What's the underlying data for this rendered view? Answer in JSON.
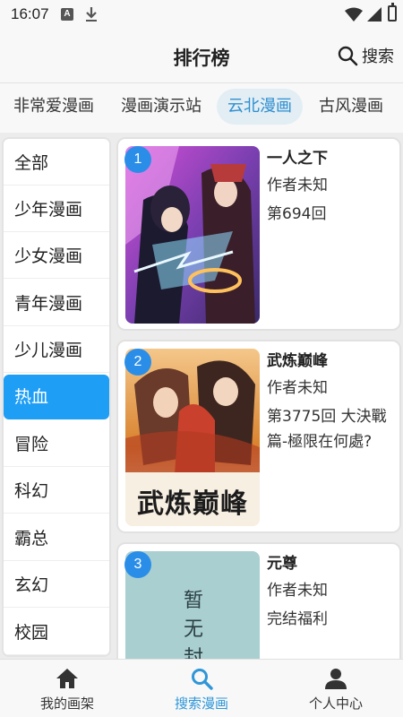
{
  "status": {
    "time": "16:07"
  },
  "header": {
    "title": "排行榜",
    "search_label": "搜索"
  },
  "tabs": [
    {
      "label": "非常爱漫画",
      "active": false
    },
    {
      "label": "漫画演示站",
      "active": false
    },
    {
      "label": "云北漫画",
      "active": true
    },
    {
      "label": "古风漫画",
      "active": false
    }
  ],
  "categories": [
    {
      "label": "全部",
      "active": false
    },
    {
      "label": "少年漫画",
      "active": false
    },
    {
      "label": "少女漫画",
      "active": false
    },
    {
      "label": "青年漫画",
      "active": false
    },
    {
      "label": "少儿漫画",
      "active": false
    },
    {
      "label": "热血",
      "active": true
    },
    {
      "label": "冒险",
      "active": false
    },
    {
      "label": "科幻",
      "active": false
    },
    {
      "label": "霸总",
      "active": false
    },
    {
      "label": "玄幻",
      "active": false
    },
    {
      "label": "校园",
      "active": false
    }
  ],
  "comics": [
    {
      "rank": "1",
      "title": "一人之下",
      "author": "作者未知",
      "chapter": "第694回",
      "cover_text": ""
    },
    {
      "rank": "2",
      "title": "武炼巅峰",
      "author": "作者未知",
      "chapter": "第3775回 大決戰篇-極限在何處?",
      "cover_text": "武炼巅峰"
    },
    {
      "rank": "3",
      "title": "元尊",
      "author": "作者未知",
      "chapter": "完结福利",
      "cover_text": "暂无封"
    }
  ],
  "bottom_nav": [
    {
      "label": "我的画架",
      "icon": "home-icon",
      "active": false
    },
    {
      "label": "搜索漫画",
      "icon": "search-icon",
      "active": true
    },
    {
      "label": "个人中心",
      "icon": "person-icon",
      "active": false
    }
  ],
  "colors": {
    "accent": "#1e9ef5",
    "rank_badge": "#2a8ee8",
    "tab_active_text": "#2f8fd0"
  }
}
